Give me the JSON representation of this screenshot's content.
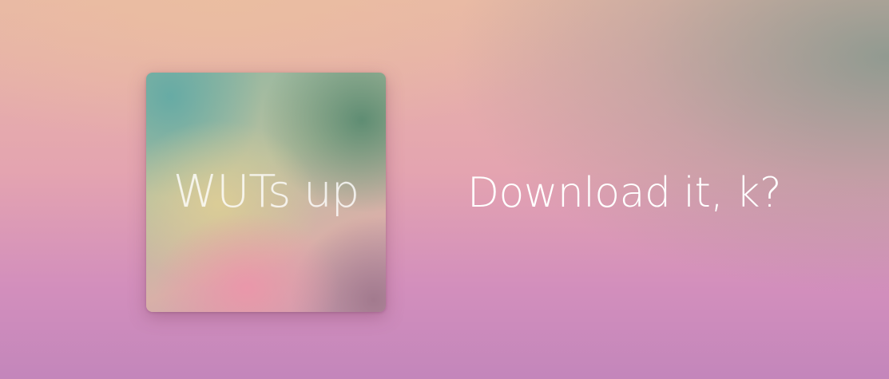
{
  "album": {
    "title": "WUTs up"
  },
  "cta": {
    "label": "Download it, k?"
  },
  "colors": {
    "background_top": "#e8b8a6",
    "background_bottom": "#c386bb",
    "text": "#ffffff"
  }
}
